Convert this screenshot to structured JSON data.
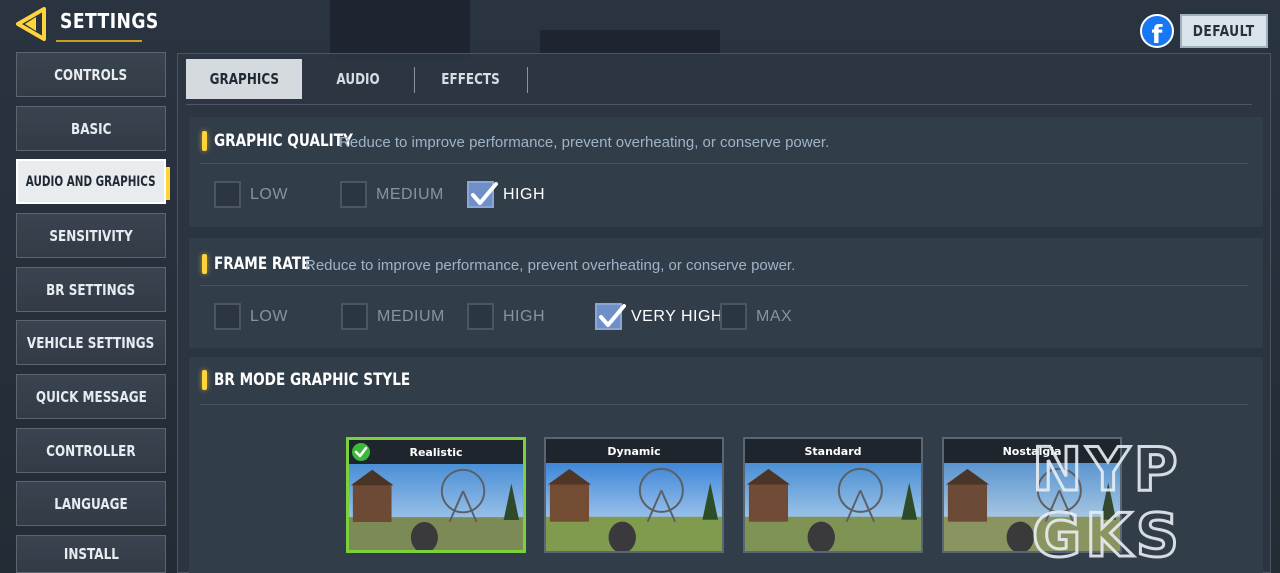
{
  "header": {
    "title": "SETTINGS",
    "default_label": "DEFAULT",
    "facebook_glyph": "f",
    "accent_color": "#ffd43b"
  },
  "sidebar": {
    "items": [
      {
        "label": "CONTROLS"
      },
      {
        "label": "BASIC"
      },
      {
        "label": "AUDIO AND GRAPHICS",
        "active": true
      },
      {
        "label": "SENSITIVITY"
      },
      {
        "label": "BR SETTINGS"
      },
      {
        "label": "VEHICLE SETTINGS"
      },
      {
        "label": "QUICK MESSAGE"
      },
      {
        "label": "CONTROLLER"
      },
      {
        "label": "LANGUAGE"
      },
      {
        "label": "INSTALL"
      }
    ]
  },
  "tabs": [
    {
      "label": "GRAPHICS",
      "active": true
    },
    {
      "label": "AUDIO"
    },
    {
      "label": "EFFECTS"
    }
  ],
  "graphic_quality": {
    "title": "GRAPHIC QUALITY",
    "description": "Reduce to improve performance, prevent overheating, or conserve power.",
    "options": [
      "LOW",
      "MEDIUM",
      "HIGH"
    ],
    "selected": "HIGH"
  },
  "frame_rate": {
    "title": "FRAME RATE",
    "description": "Reduce to improve performance, prevent overheating, or conserve power.",
    "options": [
      "LOW",
      "MEDIUM",
      "HIGH",
      "VERY HIGH",
      "MAX"
    ],
    "selected": "VERY HIGH"
  },
  "br_style": {
    "title": "BR MODE GRAPHIC STYLE",
    "styles": [
      "Realistic",
      "Dynamic",
      "Standard",
      "Nostalgia"
    ],
    "selected": "Realistic"
  },
  "watermark": {
    "lines": [
      "NYP",
      "GKS"
    ]
  }
}
